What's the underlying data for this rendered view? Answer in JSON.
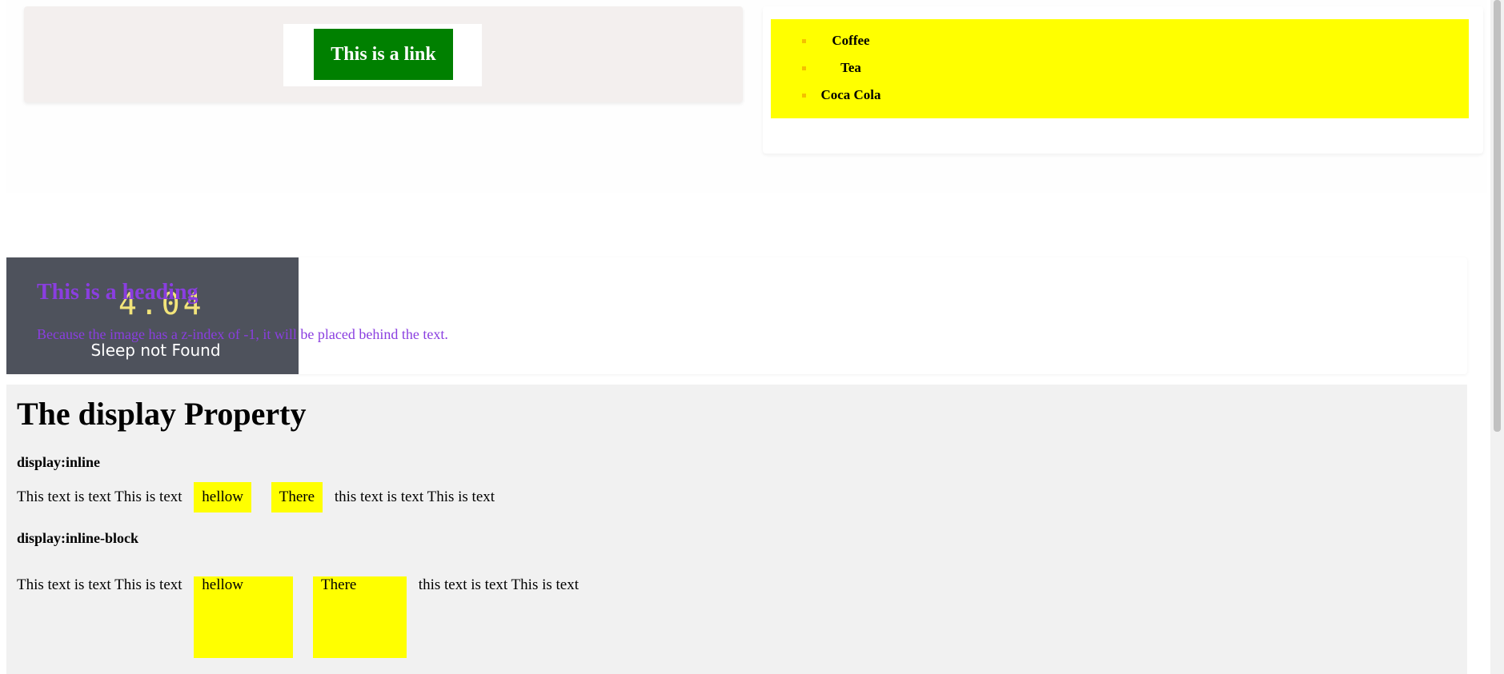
{
  "link_card": {
    "link_label": "This is a link"
  },
  "drinks": [
    "Coffee",
    "Tea",
    "Coca Cola"
  ],
  "zindex_demo": {
    "image_digits": "4.04",
    "image_caption": "Sleep not Found",
    "heading": "This is a heading",
    "text": "Because the image has a z-index of -1, it will be placed behind the text."
  },
  "display_section": {
    "title": "The display Property",
    "inline_label": "display:inline",
    "inline_row": {
      "before": "This text is text This is text",
      "box1": "hellow",
      "box2": "There",
      "after": "this text is text This is text"
    },
    "inline_block_label": "display:inline-block",
    "inline_block_row": {
      "before": "This text is text This is text",
      "box1": "hellow",
      "box2": "There",
      "after": "this text is text This is text"
    }
  },
  "colors": {
    "link_bg": "#008000",
    "list_bg": "#ffff00",
    "heading_purple": "#8a3ee0",
    "image_bg": "#4e525c",
    "section_bg": "#f1f1f1"
  }
}
